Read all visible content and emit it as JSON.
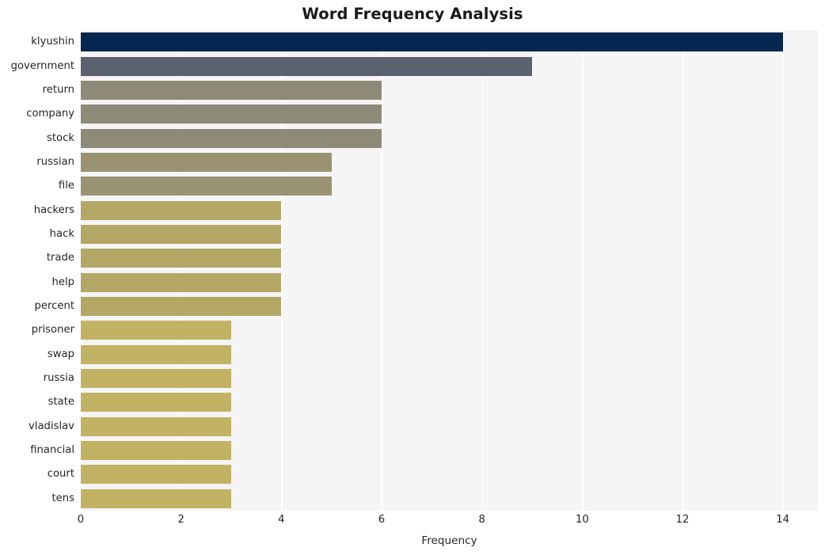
{
  "chart_data": {
    "type": "bar",
    "orientation": "horizontal",
    "title": "Word Frequency Analysis",
    "xlabel": "Frequency",
    "ylabel": "",
    "categories": [
      "klyushin",
      "government",
      "return",
      "company",
      "stock",
      "russian",
      "file",
      "hackers",
      "hack",
      "trade",
      "help",
      "percent",
      "prisoner",
      "swap",
      "russia",
      "state",
      "vladislav",
      "financial",
      "court",
      "tens"
    ],
    "values": [
      14,
      9,
      6,
      6,
      6,
      5,
      5,
      4,
      4,
      4,
      4,
      4,
      3,
      3,
      3,
      3,
      3,
      3,
      3,
      3
    ],
    "bar_colors": [
      "#04264f",
      "#5c616f",
      "#8d8b78",
      "#8d8b78",
      "#8d8b78",
      "#9a9372",
      "#9a9372",
      "#b3a765",
      "#b3a765",
      "#b3a765",
      "#b3a765",
      "#b3a765",
      "#c2b264",
      "#c2b264",
      "#c2b264",
      "#c2b264",
      "#c2b264",
      "#c2b264",
      "#c2b264",
      "#c2b264"
    ],
    "xticks": [
      "0",
      "2",
      "4",
      "6",
      "8",
      "10",
      "12",
      "14"
    ],
    "xtick_values": [
      0,
      2,
      4,
      6,
      8,
      10,
      12,
      14
    ],
    "xlim": [
      0,
      14.7
    ],
    "grid": "vertical",
    "legend": "none",
    "plot_background": "#f5f5f6",
    "gridline_color": "#ffffff",
    "figure_background": "#ffffff",
    "title_color": "#1a1a1a",
    "tick_label_color": "#262626"
  }
}
